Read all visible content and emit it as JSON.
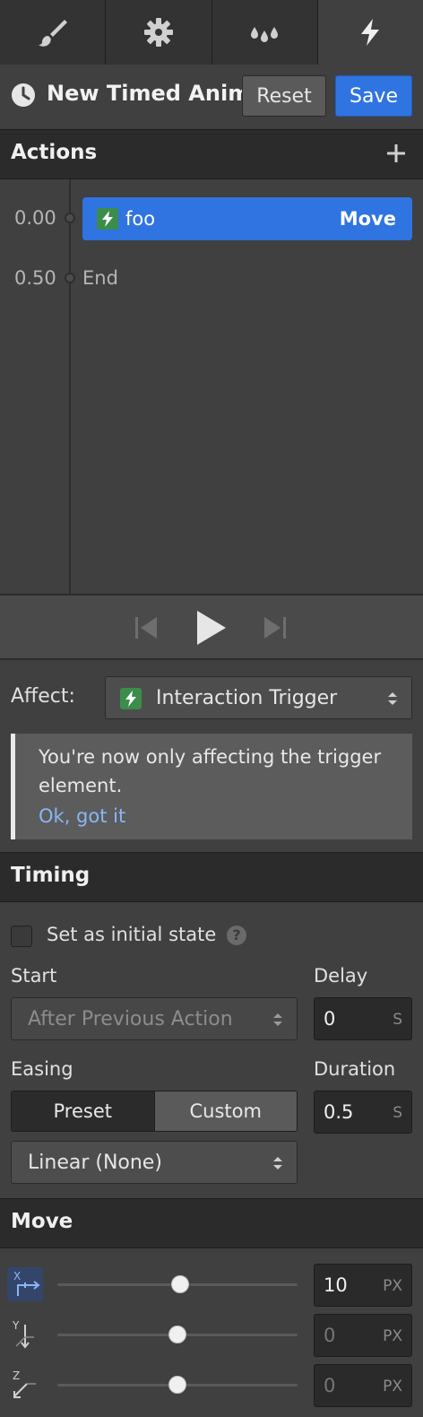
{
  "tabs": [
    {
      "icon": "brush-icon"
    },
    {
      "icon": "gear-icon"
    },
    {
      "icon": "drops-icon"
    },
    {
      "icon": "lightning-icon",
      "active": true
    }
  ],
  "header": {
    "title": "New Timed Anim...",
    "reset_label": "Reset",
    "save_label": "Save"
  },
  "actions": {
    "heading": "Actions",
    "items": [
      {
        "time": "0.00",
        "name": "foo",
        "type": "Move"
      }
    ],
    "end": {
      "time": "0.50",
      "label": "End"
    }
  },
  "affect": {
    "label": "Affect:",
    "value": "Interaction Trigger",
    "notice": "You're now only affecting the trigger element.",
    "notice_link": "Ok, got it"
  },
  "timing": {
    "heading": "Timing",
    "initial_state_label": "Set as initial state",
    "help_glyph": "?",
    "start_label": "Start",
    "start_value": "After Previous Action",
    "delay_label": "Delay",
    "delay_value": "0",
    "delay_unit": "S",
    "easing_label": "Easing",
    "easing_preset": "Preset",
    "easing_custom": "Custom",
    "easing_value": "Linear (None)",
    "duration_label": "Duration",
    "duration_value": "0.5",
    "duration_unit": "S"
  },
  "move": {
    "heading": "Move",
    "axes": [
      {
        "axis": "X",
        "value": "10",
        "unit": "PX",
        "slider_fraction": 0.51
      },
      {
        "axis": "Y",
        "value": "0",
        "unit": "PX",
        "slider_fraction": 0.5
      },
      {
        "axis": "Z",
        "value": "0",
        "unit": "PX",
        "slider_fraction": 0.5
      }
    ]
  },
  "colors": {
    "accent": "#2f74e0",
    "trigger_green": "#3c8d4a",
    "link": "#8ab6f5"
  }
}
